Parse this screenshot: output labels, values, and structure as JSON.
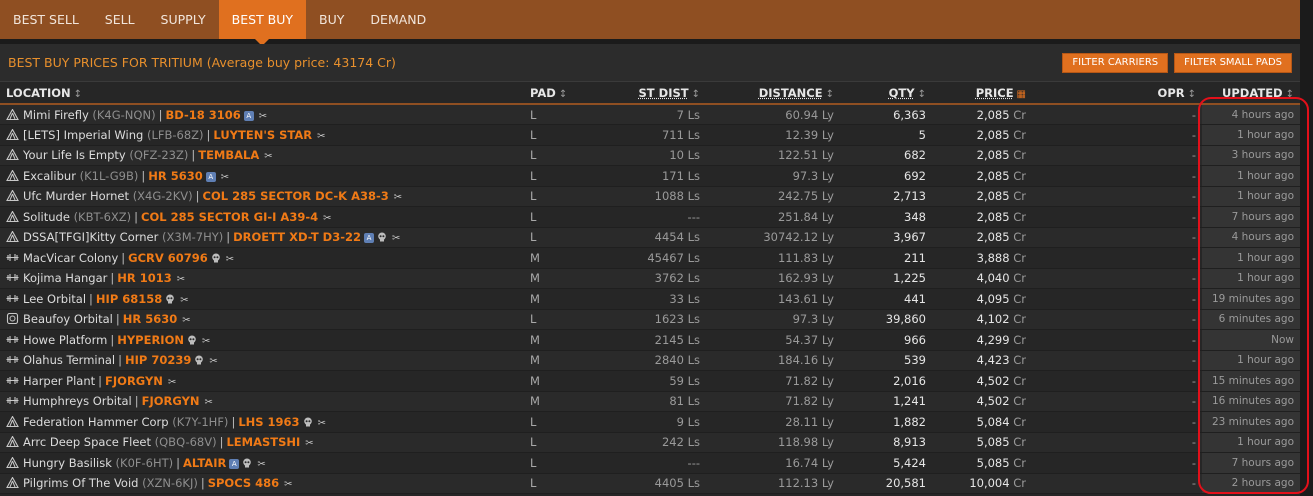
{
  "nav": {
    "tabs": [
      "BEST SELL",
      "SELL",
      "SUPPLY",
      "BEST BUY",
      "BUY",
      "DEMAND"
    ],
    "active": 3
  },
  "panel": {
    "title": "BEST BUY PRICES FOR TRITIUM (Average buy price: 43174 Cr)",
    "filter_carriers": "FILTER CARRIERS",
    "filter_small_pads": "FILTER SMALL PADS"
  },
  "columns": {
    "location": "LOCATION",
    "pad": "PAD",
    "st_dist": "ST DIST",
    "distance": "DISTANCE",
    "qty": "QTY",
    "price": "PRICE",
    "opr": "OPR",
    "updated": "UPDATED"
  },
  "colors": {
    "accent": "#e0701f",
    "nav_bg": "#8f4f22",
    "system": "#f07a16",
    "highlight": "#e3101a"
  },
  "rows": [
    {
      "icon": "carrier",
      "station": "Mimi Firefly",
      "code": "(K4G-NQN)",
      "system": "BD-18 3106",
      "badge": true,
      "skull": false,
      "pad": "L",
      "st_dist": "7 Ls",
      "distance": "60.94 Ly",
      "qty": "6,363",
      "price": "2,085",
      "cr": "Cr",
      "opr": "-",
      "updated": "4 hours ago"
    },
    {
      "icon": "carrier",
      "station": "[LETS] Imperial Wing",
      "code": "(LFB-68Z)",
      "system": "LUYTEN'S STAR",
      "badge": false,
      "skull": false,
      "pad": "L",
      "st_dist": "711 Ls",
      "distance": "12.39 Ly",
      "qty": "5",
      "price": "2,085",
      "cr": "Cr",
      "opr": "-",
      "updated": "1 hour ago"
    },
    {
      "icon": "carrier",
      "station": "Your Life Is Empty",
      "code": "(QFZ-23Z)",
      "system": "TEMBALA",
      "badge": false,
      "skull": false,
      "pad": "L",
      "st_dist": "10 Ls",
      "distance": "122.51 Ly",
      "qty": "682",
      "price": "2,085",
      "cr": "Cr",
      "opr": "-",
      "updated": "3 hours ago"
    },
    {
      "icon": "carrier",
      "station": "Excalibur",
      "code": "(K1L-G9B)",
      "system": "HR 5630",
      "badge": true,
      "skull": false,
      "pad": "L",
      "st_dist": "171 Ls",
      "distance": "97.3 Ly",
      "qty": "692",
      "price": "2,085",
      "cr": "Cr",
      "opr": "-",
      "updated": "1 hour ago"
    },
    {
      "icon": "carrier",
      "station": "Ufc Murder Hornet",
      "code": "(X4G-2KV)",
      "system": "COL 285 SECTOR DC-K A38-3",
      "badge": false,
      "skull": false,
      "pad": "L",
      "st_dist": "1088 Ls",
      "distance": "242.75 Ly",
      "qty": "2,713",
      "price": "2,085",
      "cr": "Cr",
      "opr": "-",
      "updated": "1 hour ago"
    },
    {
      "icon": "carrier",
      "station": "Solitude",
      "code": "(KBT-6XZ)",
      "system": "COL 285 SECTOR GI-I A39-4",
      "badge": false,
      "skull": false,
      "pad": "L",
      "st_dist": "---",
      "distance": "251.84 Ly",
      "qty": "348",
      "price": "2,085",
      "cr": "Cr",
      "opr": "-",
      "updated": "7 hours ago"
    },
    {
      "icon": "carrier",
      "station": "DSSA[TFGI]Kitty Corner",
      "code": "(X3M-7HY)",
      "system": "DROETT XD-T D3-22",
      "badge": true,
      "skull": true,
      "pad": "L",
      "st_dist": "4454 Ls",
      "distance": "30742.12 Ly",
      "qty": "3,967",
      "price": "2,085",
      "cr": "Cr",
      "opr": "-",
      "updated": "4 hours ago"
    },
    {
      "icon": "outpost",
      "station": "MacVicar Colony",
      "code": "",
      "system": "GCRV 60796",
      "badge": false,
      "skull": true,
      "pad": "M",
      "st_dist": "45467 Ls",
      "distance": "111.83 Ly",
      "qty": "211",
      "price": "3,888",
      "cr": "Cr",
      "opr": "-",
      "updated": "1 hour ago"
    },
    {
      "icon": "outpost",
      "station": "Kojima Hangar",
      "code": "",
      "system": "HR 1013",
      "badge": false,
      "skull": false,
      "pad": "M",
      "st_dist": "3762 Ls",
      "distance": "162.93 Ly",
      "qty": "1,225",
      "price": "4,040",
      "cr": "Cr",
      "opr": "-",
      "updated": "1 hour ago"
    },
    {
      "icon": "outpost",
      "station": "Lee Orbital",
      "code": "",
      "system": "HIP 68158",
      "badge": false,
      "skull": true,
      "pad": "M",
      "st_dist": "33 Ls",
      "distance": "143.61 Ly",
      "qty": "441",
      "price": "4,095",
      "cr": "Cr",
      "opr": "-",
      "updated": "19 minutes ago"
    },
    {
      "icon": "station",
      "station": "Beaufoy Orbital",
      "code": "",
      "system": "HR 5630",
      "badge": false,
      "skull": false,
      "pad": "L",
      "st_dist": "1623 Ls",
      "distance": "97.3 Ly",
      "qty": "39,860",
      "price": "4,102",
      "cr": "Cr",
      "opr": "-",
      "updated": "6 minutes ago"
    },
    {
      "icon": "outpost",
      "station": "Howe Platform",
      "code": "",
      "system": "HYPERION",
      "badge": false,
      "skull": true,
      "pad": "M",
      "st_dist": "2145 Ls",
      "distance": "54.37 Ly",
      "qty": "966",
      "price": "4,299",
      "cr": "Cr",
      "opr": "-",
      "updated": "Now"
    },
    {
      "icon": "outpost",
      "station": "Olahus Terminal",
      "code": "",
      "system": "HIP 70239",
      "badge": false,
      "skull": true,
      "pad": "M",
      "st_dist": "2840 Ls",
      "distance": "184.16 Ly",
      "qty": "539",
      "price": "4,423",
      "cr": "Cr",
      "opr": "-",
      "updated": "1 hour ago"
    },
    {
      "icon": "outpost",
      "station": "Harper Plant",
      "code": "",
      "system": "FJORGYN",
      "badge": false,
      "skull": false,
      "pad": "M",
      "st_dist": "59 Ls",
      "distance": "71.82 Ly",
      "qty": "2,016",
      "price": "4,502",
      "cr": "Cr",
      "opr": "-",
      "updated": "15 minutes ago"
    },
    {
      "icon": "outpost",
      "station": "Humphreys Orbital",
      "code": "",
      "system": "FJORGYN",
      "badge": false,
      "skull": false,
      "pad": "M",
      "st_dist": "81 Ls",
      "distance": "71.82 Ly",
      "qty": "1,241",
      "price": "4,502",
      "cr": "Cr",
      "opr": "-",
      "updated": "16 minutes ago"
    },
    {
      "icon": "carrier",
      "station": "Federation Hammer Corp",
      "code": "(K7Y-1HF)",
      "system": "LHS 1963",
      "badge": false,
      "skull": true,
      "pad": "L",
      "st_dist": "9 Ls",
      "distance": "28.11 Ly",
      "qty": "1,882",
      "price": "5,084",
      "cr": "Cr",
      "opr": "-",
      "updated": "23 minutes ago"
    },
    {
      "icon": "carrier",
      "station": "Arrc Deep Space Fleet",
      "code": "(QBQ-68V)",
      "system": "LEMASTSHI",
      "badge": false,
      "skull": false,
      "pad": "L",
      "st_dist": "242 Ls",
      "distance": "118.98 Ly",
      "qty": "8,913",
      "price": "5,085",
      "cr": "Cr",
      "opr": "-",
      "updated": "1 hour ago"
    },
    {
      "icon": "carrier",
      "station": "Hungry Basilisk",
      "code": "(K0F-6HT)",
      "system": "ALTAIR",
      "badge": true,
      "skull": true,
      "pad": "L",
      "st_dist": "---",
      "distance": "16.74 Ly",
      "qty": "5,424",
      "price": "5,085",
      "cr": "Cr",
      "opr": "-",
      "updated": "7 hours ago"
    },
    {
      "icon": "carrier",
      "station": "Pilgrims Of The Void",
      "code": "(XZN-6KJ)",
      "system": "SPOCS 486",
      "badge": false,
      "skull": false,
      "pad": "L",
      "st_dist": "4405 Ls",
      "distance": "112.13 Ly",
      "qty": "20,581",
      "price": "10,004",
      "cr": "Cr",
      "opr": "-",
      "updated": "2 hours ago"
    }
  ]
}
